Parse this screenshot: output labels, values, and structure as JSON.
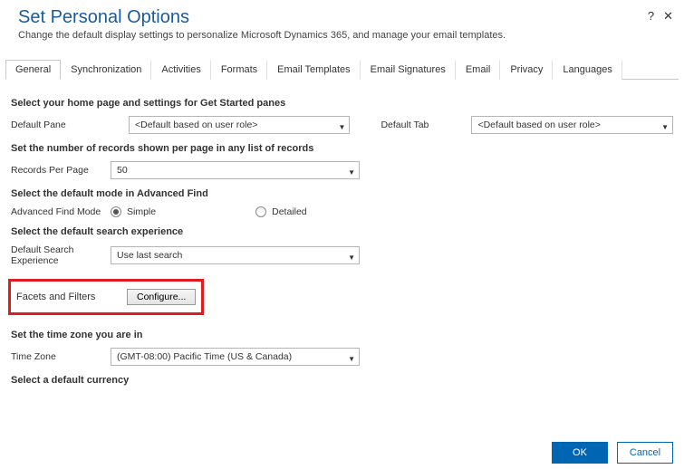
{
  "header": {
    "title": "Set Personal Options",
    "subtitle": "Change the default display settings to personalize Microsoft Dynamics 365, and manage your email templates.",
    "help_icon": "?",
    "close_icon": "✕"
  },
  "tabs": [
    "General",
    "Synchronization",
    "Activities",
    "Formats",
    "Email Templates",
    "Email Signatures",
    "Email",
    "Privacy",
    "Languages"
  ],
  "sections": {
    "homepage": {
      "title": "Select your home page and settings for Get Started panes",
      "default_pane_label": "Default Pane",
      "default_pane_value": "<Default based on user role>",
      "default_tab_label": "Default Tab",
      "default_tab_value": "<Default based on user role>"
    },
    "records": {
      "title": "Set the number of records shown per page in any list of records",
      "records_label": "Records Per Page",
      "records_value": "50"
    },
    "advfind": {
      "title": "Select the default mode in Advanced Find",
      "mode_label": "Advanced Find Mode",
      "simple_label": "Simple",
      "detailed_label": "Detailed"
    },
    "search": {
      "title": "Select the default search experience",
      "exp_label": "Default Search Experience",
      "exp_value": "Use last search",
      "facets_label": "Facets and Filters",
      "configure_btn": "Configure..."
    },
    "timezone": {
      "title": "Set the time zone you are in",
      "tz_label": "Time Zone",
      "tz_value": "(GMT-08:00) Pacific Time (US & Canada)"
    },
    "currency": {
      "title": "Select a default currency"
    }
  },
  "footer": {
    "ok": "OK",
    "cancel": "Cancel"
  }
}
